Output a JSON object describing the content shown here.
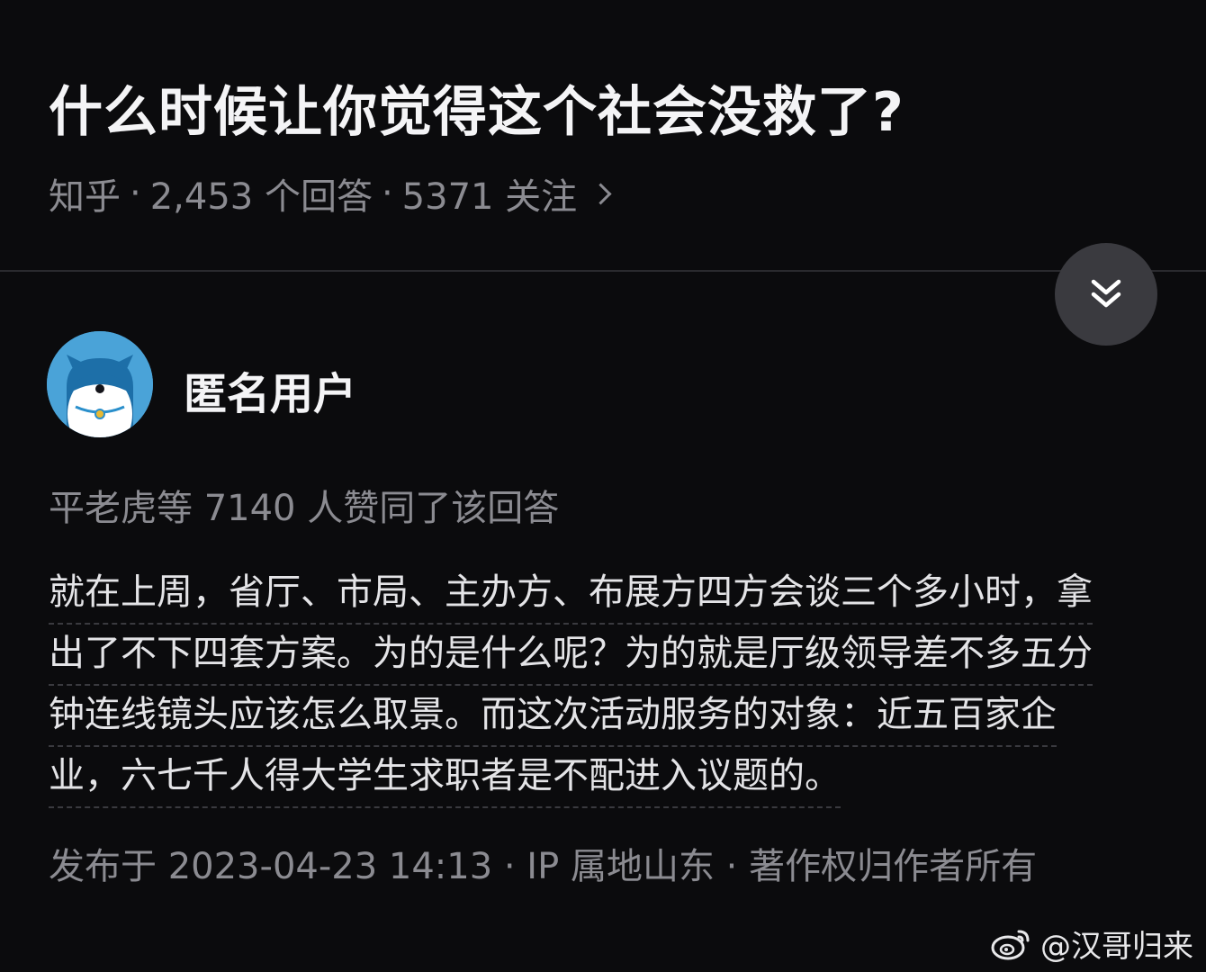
{
  "question": {
    "title": "什么时候让你觉得这个社会没救了?",
    "source": "知乎",
    "answers": "2,453 个回答",
    "followers": "5371 关注"
  },
  "answer": {
    "author": "匿名用户",
    "votes": "平老虎等 7140 人赞同了该回答",
    "lines": [
      "就在上周，省厅、市局、主办方、布展方四方会谈三个多小时，拿",
      "出了不下四套方案。为的是什么呢？为的就是厅级领导差不多五分",
      "钟连线镜头应该怎么取景。而这次活动服务的对象：近五百家企",
      "业，六七千人得大学生求职者是不配进入议题的。"
    ],
    "footer": "发布于 2023-04-23 14:13 · IP 属地山东 · 著作权归作者所有"
  },
  "icons": {
    "collapse": "double-chevron-down-icon",
    "weibo": "weibo-logo-icon"
  },
  "watermark": "@汉哥归来",
  "colors": {
    "background": "#0b0b0d",
    "text_primary": "#f4f4f6",
    "text_secondary": "#8b8b91",
    "avatar_bg": "#4aa3d8"
  }
}
